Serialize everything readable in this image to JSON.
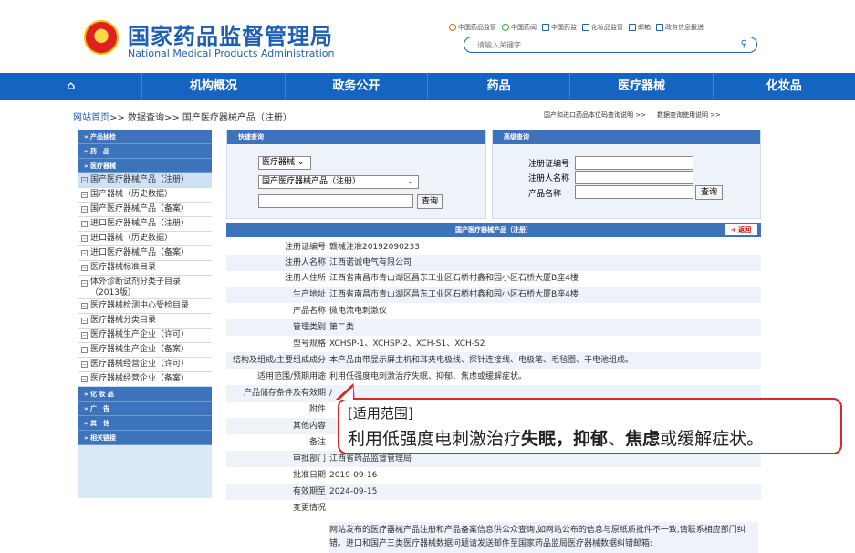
{
  "header": {
    "logo_cn": "国家药品监督管理局",
    "logo_en": "National Medical Products Administration",
    "links": [
      "中国药品监管",
      "中国药闻",
      "中国药监",
      "化妆品监管",
      "邮箱",
      "政务信息报送"
    ],
    "search_placeholder": "请输入关键字"
  },
  "nav": {
    "items": [
      "机构概况",
      "政务公开",
      "药品",
      "医疗器械",
      "化妆品"
    ]
  },
  "breadcrumb": {
    "home": "网站首页",
    "sep1": ">>",
    "query": "数据查询",
    "sep2": ">>",
    "current": "国产医疗器械产品（注册）",
    "right1": "国产和进口药品本位码查询说明 >>",
    "right2": "数据查询使用说明 >>"
  },
  "sidebar": {
    "cat_cosmetics_head": "» 产品抽检",
    "cat_drug": "» 药　品",
    "cat_device": "» 医疗器械",
    "device_items": [
      "国产医疗器械产品（注册）",
      "国产器械（历史数据）",
      "国产医疗器械产品（备案）",
      "进口医疗器械产品（注册）",
      "进口器械（历史数据）",
      "进口医疗器械产品（备案）",
      "医疗器械标准目录",
      "体外诊断试剂分类子目录（2013版）",
      "医疗器械检测中心受检目录",
      "医疗器械分类目录",
      "医疗器械生产企业（许可）",
      "医疗器械生产企业（备案）",
      "医疗器械经营企业（许可）",
      "医疗器械经营企业（备案）"
    ],
    "cat_cosmetic": "» 化 妆 品",
    "cat_ad": "» 广　告",
    "cat_other": "» 其　他",
    "cat_links": "» 相关链接"
  },
  "quick_query": {
    "title": "快速查询",
    "select1": "医疗器械",
    "select2": "国产医疗器械产品（注册）",
    "button": "查询"
  },
  "advanced_query": {
    "title": "高级查询",
    "label_reg_no": "注册证编号",
    "label_reg_name": "注册人名称",
    "label_product": "产品名称",
    "button": "查询"
  },
  "detail": {
    "title": "国产医疗器械产品（注册）",
    "back": "返回",
    "rows": [
      {
        "k": "注册证编号",
        "v": "赣械注准20192090233"
      },
      {
        "k": "注册人名称",
        "v": "江西诺诚电气有限公司"
      },
      {
        "k": "注册人住所",
        "v": "江西省南昌市青山湖区昌东工业区石桥村鑫和园小区石桥大厦B座4楼"
      },
      {
        "k": "生产地址",
        "v": "江西省南昌市青山湖区昌东工业区石桥村鑫和园小区石桥大厦B座4楼"
      },
      {
        "k": "产品名称",
        "v": "微电流电刺激仪"
      },
      {
        "k": "管理类别",
        "v": "第二类"
      },
      {
        "k": "型号规格",
        "v": "XCHSP-1、XCHSP-2、XCH-S1、XCH-S2"
      },
      {
        "k": "结构及组成/主要组成成分",
        "v": "本产品由带显示屏主机和耳夹电极线、探针连接线、电极笔、毛毡圈、干电池组成。"
      },
      {
        "k": "适用范围/预期用途",
        "v": "利用低强度电刺激治疗失眠、抑郁、焦虑或缓解症状。"
      },
      {
        "k": "产品储存条件及有效期",
        "v": "/"
      },
      {
        "k": "附件",
        "v": ""
      },
      {
        "k": "其他内容",
        "v": ""
      },
      {
        "k": "备注",
        "v": ""
      },
      {
        "k": "审批部门",
        "v": "江西省药品监督管理局"
      },
      {
        "k": "批准日期",
        "v": "2019-09-16"
      },
      {
        "k": "有效期至",
        "v": "2024-09-15"
      },
      {
        "k": "变更情况",
        "v": ""
      }
    ],
    "disclaimer": "网站发布的医疗器械产品注册和产品备案信息供公众查询,如网站公布的信息与原纸质批件不一致,请联系相应部门纠错。进口和国产三类医疗器械数据问题请发送邮件至国家药品监局医疗器械数据纠错邮箱:"
  },
  "callout": {
    "title": "[适用范围]",
    "pre": "利用低强度电刺激治疗",
    "b1": "失眠",
    "sep1": "，",
    "b2": "抑郁",
    "sep2": "、",
    "b3": "焦虑",
    "post": "或缓解症状。",
    "color": "#e02525"
  }
}
